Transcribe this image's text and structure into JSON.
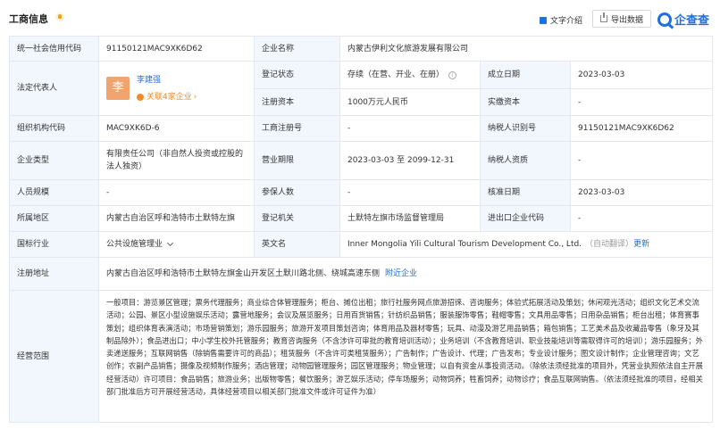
{
  "header": {
    "title": "工商信息",
    "intro_label": "文字介绍",
    "export_label": "导出数据",
    "logo_text": "企查查"
  },
  "fields": {
    "credit_code": {
      "label": "统一社会信用代码",
      "value": "91150121MAC9XK6D62"
    },
    "company_name": {
      "label": "企业名称",
      "value": "内蒙古伊利文化旅游发展有限公司"
    },
    "legal_rep": {
      "label": "法定代表人",
      "avatar": "李",
      "name": "李建强",
      "relation": "关联4家企业"
    },
    "reg_status": {
      "label": "登记状态",
      "value": "存续（在营、开业、在册）"
    },
    "est_date": {
      "label": "成立日期",
      "value": "2023-03-03"
    },
    "reg_capital": {
      "label": "注册资本",
      "value": "1000万元人民币"
    },
    "paid_capital": {
      "label": "实缴资本",
      "value": "-"
    },
    "org_code": {
      "label": "组织机构代码",
      "value": "MAC9XK6D-6"
    },
    "biz_reg_no": {
      "label": "工商注册号",
      "value": "-"
    },
    "tax_id": {
      "label": "纳税人识别号",
      "value": "91150121MAC9XK6D62"
    },
    "company_type": {
      "label": "企业类型",
      "value": "有限责任公司（非自然人投资或控股的法人独资）"
    },
    "biz_term": {
      "label": "营业期限",
      "value": "2023-03-03 至 2099-12-31"
    },
    "taxpayer_qual": {
      "label": "纳税人资质",
      "value": "-"
    },
    "staff_size": {
      "label": "人员规模",
      "value": "-"
    },
    "insured": {
      "label": "参保人数",
      "value": "-"
    },
    "approval_date": {
      "label": "核准日期",
      "value": "2023-03-03"
    },
    "region": {
      "label": "所属地区",
      "value": "内蒙古自治区呼和浩特市土默特左旗"
    },
    "reg_authority": {
      "label": "登记机关",
      "value": "土默特左旗市场监督管理局"
    },
    "ie_code": {
      "label": "进出口企业代码",
      "value": "-"
    },
    "industry": {
      "label": "国标行业",
      "value": "公共设施管理业"
    },
    "english_name": {
      "label": "英文名",
      "value": "Inner Mongolia Yili Cultural Tourism Development Co., Ltd.",
      "note": "（自动翻译）",
      "link": "更新"
    },
    "address": {
      "label": "注册地址",
      "value": "内蒙古自治区呼和浩特市土默特左旗金山开发区土默川路北侧、绕城高速东侧",
      "link": "附近企业"
    },
    "scope": {
      "label": "经营范围",
      "value": "一般项目：游览景区管理；票务代理服务；商业综合体管理服务；柜台、摊位出租；旅行社服务网点旅游招徕、咨询服务；体验式拓展活动及策划；休闲观光活动；组织文化艺术交流活动；公园、景区小型设施娱乐活动；露营地服务；会议及展览服务；日用百货销售；针纺织品销售；服装服饰零售；鞋帽零售；文具用品零售；日用杂品销售；柜台出租；体育赛事策划；组织体育表演活动；市场营销策划；游乐园服务；旅游开发项目策划咨询；体育用品及器材零售；玩具、动漫及游艺用品销售；箱包销售；工艺美术品及收藏品零售（象牙及其制品除外）；食品进出口；中小学生校外托管服务；教育咨询服务（不含涉许可审批的教育培训活动）；业务培训（不含教育培训、职业技能培训等需取得许可的培训）；游乐园服务；外卖递送服务；互联网销售（除销售需要许可的商品）；租赁服务（不含许可类租赁服务）；广告制作；广告设计、代理；广告发布；专业设计服务；图文设计制作；企业管理咨询；文艺创作；农副产品销售；摄像及视频制作服务；酒店管理；动物园管理服务；园区管理服务；物业管理；以自有资金从事投资活动。（除依法须经批准的项目外，凭营业执照依法自主开展经营活动）许可项目：食品销售；旅游业务；出版物零售；餐饮服务；游艺娱乐活动；停车场服务；动物饲养；牲畜饲养；动物诊疗；食品互联网销售。（依法须经批准的项目，经相关部门批准后方可开展经营活动，具体经营项目以相关部门批准文件或许可证件为准）"
    }
  }
}
